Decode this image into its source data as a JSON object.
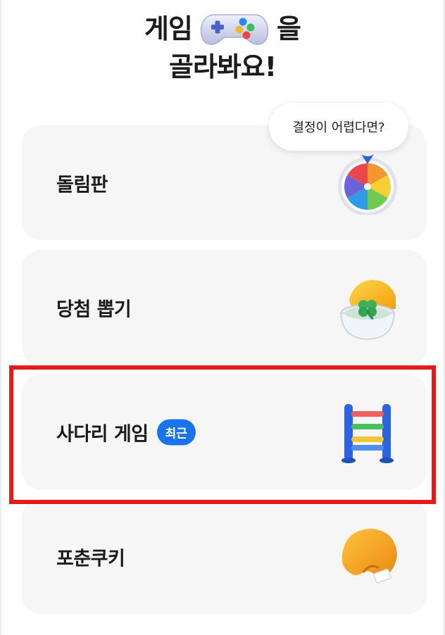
{
  "header": {
    "title_part1": "게임",
    "title_part2": "을",
    "title_line2": "골라봐요!",
    "title_icon": "gamepad-icon"
  },
  "tooltip": {
    "text": "결정이 어렵다면?"
  },
  "games": [
    {
      "label": "돌림판",
      "icon": "roulette-wheel-icon"
    },
    {
      "label": "당첨 뽑기",
      "icon": "lucky-capsule-icon"
    },
    {
      "label": "사다리 게임",
      "badge": "최근",
      "icon": "ladder-icon"
    },
    {
      "label": "포춘쿠키",
      "icon": "fortune-cookie-icon"
    }
  ],
  "colors": {
    "card_bg": "#f6f6f7",
    "badge_bg": "#1a73e8",
    "highlight": "#e21b1b"
  }
}
